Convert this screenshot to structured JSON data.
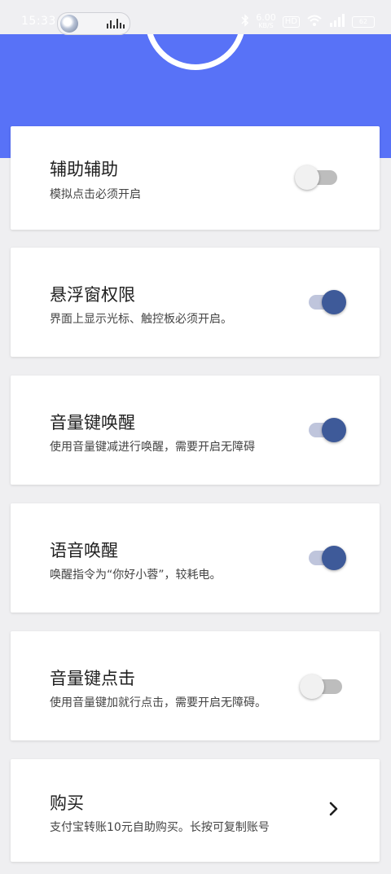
{
  "status_bar": {
    "time": "15:33",
    "net_speed_value": "6.00",
    "net_speed_unit": "KB/S",
    "hd_badge": "HD",
    "battery": "62"
  },
  "settings": [
    {
      "title": "辅助辅助",
      "description": "模拟点击必须开启",
      "enabled": false
    },
    {
      "title": "悬浮窗权限",
      "description": "界面上显示光标、触控板必须开启。",
      "enabled": true
    },
    {
      "title": "音量键唤醒",
      "description": "使用音量键减进行唤醒，需要开启无障碍",
      "enabled": true
    },
    {
      "title": "语音唤醒",
      "description": "唤醒指令为“你好小蓉”，较耗电。",
      "enabled": true
    },
    {
      "title": "音量键点击",
      "description": "使用音量键加就行点击，需要开启无障碍。",
      "enabled": false
    }
  ],
  "purchase": {
    "title": "购买",
    "description": "支付宝转账10元自助购买。长按可复制账号",
    "icon": "chevron-right-icon"
  },
  "colors": {
    "header": "#5872f7",
    "toggle_on_thumb": "#3e5a99",
    "toggle_on_track": "#bfc5dc",
    "toggle_off_thumb": "#f1f1f1",
    "toggle_off_track": "#bdbdbd"
  }
}
